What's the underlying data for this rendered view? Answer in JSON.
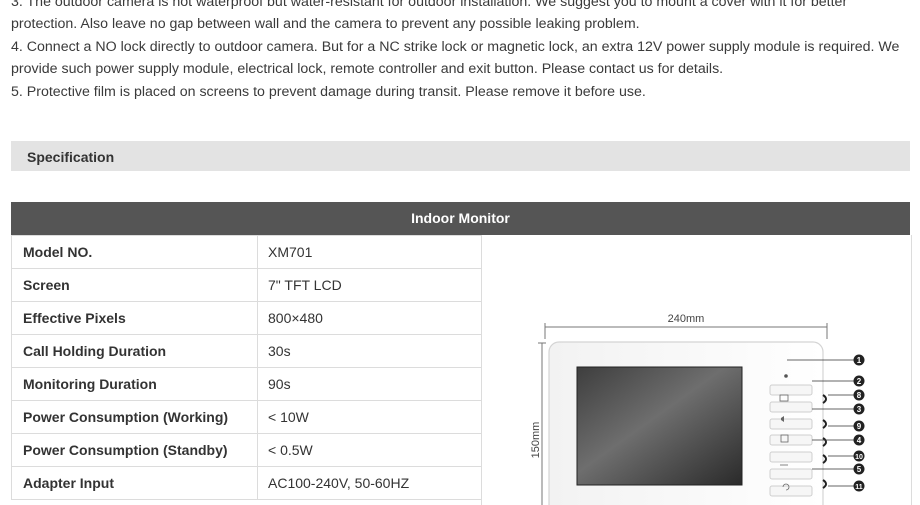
{
  "notes": [
    "3. The outdoor camera is not waterproof but water-resistant for outdoor installation. We suggest you to mount a cover with it for better",
    "protection. Also leave no gap between wall and the camera to prevent any possible leaking problem.",
    "4. Connect a NO lock directly to outdoor camera. But for a NC strike lock or magnetic lock, an extra 12V power supply module is required. We",
    "provide such power supply module, electrical lock, remote controller and exit button. Please contact us for details.",
    "5. Protective film is placed on screens to prevent damage during transit. Please remove it before use."
  ],
  "specification": {
    "title": "Specification"
  },
  "table": {
    "header": "Indoor Monitor",
    "rows": [
      {
        "label": "Model NO.",
        "value": "XM701"
      },
      {
        "label": "Screen",
        "value": "7\" TFT LCD"
      },
      {
        "label": "Effective Pixels",
        "value": "800×480"
      },
      {
        "label": "Call Holding Duration",
        "value": "30s"
      },
      {
        "label": "Monitoring Duration",
        "value": "90s"
      },
      {
        "label": "Power Consumption (Working)",
        "value": "< 10W"
      },
      {
        "label": "Power Consumption (Standby)",
        "value": "< 0.5W"
      },
      {
        "label": "Adapter Input",
        "value": "AC100-240V, 50-60HZ"
      }
    ]
  },
  "figure": {
    "width_label": "240mm",
    "height_label": "150mm",
    "callouts": [
      "1",
      "2",
      "8",
      "3",
      "9",
      "4",
      "10",
      "5",
      "11"
    ]
  }
}
